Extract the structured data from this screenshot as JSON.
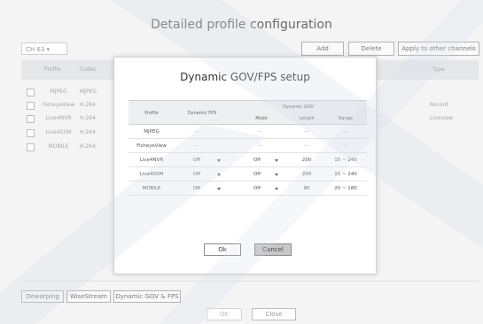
{
  "page": {
    "title": "Detailed profile configuration"
  },
  "top": {
    "channel": "CH 63",
    "add": "Add",
    "delete": "Delete",
    "apply": "Apply to other channels"
  },
  "bgtable": {
    "headers": {
      "profile": "Profile",
      "codec": "Codec",
      "type": "Type"
    },
    "rows": [
      {
        "profile": "MJPEG",
        "codec": "MJPEG",
        "type": ""
      },
      {
        "profile": "FisheyeView",
        "codec": "H.264",
        "type": "Record"
      },
      {
        "profile": "Live4NVR",
        "codec": "H.264",
        "type": "Liveview"
      },
      {
        "profile": "Live4SSM",
        "codec": "H.264",
        "type": ""
      },
      {
        "profile": "MOBILE",
        "codec": "H.264",
        "type": ""
      }
    ]
  },
  "bottom": {
    "dewarping": "Dewarping",
    "wisestream": "WiseStream",
    "dynamic": "Dynamic GOV & FPS",
    "ok": "OK",
    "close": "Close"
  },
  "modal": {
    "title": "Dynamic GOV/FPS setup",
    "headers": {
      "profile": "Profile",
      "fps": "Dynamic FPS",
      "gov": "Dynamic GOV",
      "mode": "Mode",
      "length": "Length",
      "range": "Range"
    },
    "rows": [
      {
        "profile": "MJPEG",
        "fps": "—",
        "mode": "—",
        "length": "—",
        "range": "—"
      },
      {
        "profile": "FisheyeView",
        "fps": "—",
        "mode": "—",
        "length": "—",
        "range": "—"
      },
      {
        "profile": "Live4NVR",
        "fps": "Off",
        "mode": "Off",
        "length": "200",
        "range": "15 ~ 240"
      },
      {
        "profile": "Live4SSM",
        "fps": "Off",
        "mode": "Off",
        "length": "200",
        "range": "15 ~ 240"
      },
      {
        "profile": "MOBILE",
        "fps": "Off",
        "mode": "Off",
        "length": "90",
        "range": "20 ~ 180"
      }
    ],
    "ok": "Ok",
    "cancel": "Cancel"
  },
  "colors": {
    "cancel_bg": "#c8c8c8",
    "header_bg": "#eeeff1"
  }
}
